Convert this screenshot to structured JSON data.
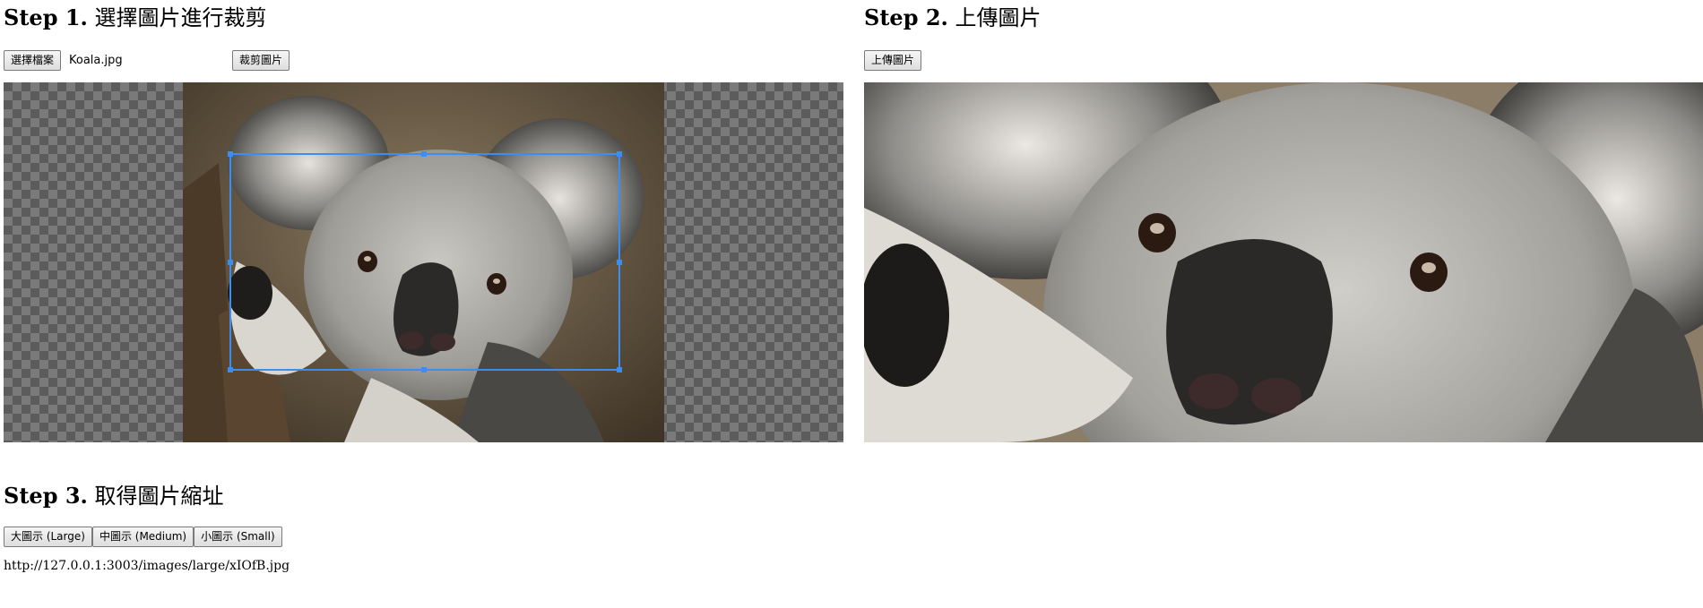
{
  "step1": {
    "number": "Step 1.",
    "title": "選擇圖片進行裁剪",
    "choose_file_label": "選擇檔案",
    "file_name": "Koala.jpg",
    "crop_button_label": "裁剪圖片"
  },
  "step2": {
    "number": "Step 2.",
    "title": "上傳圖片",
    "upload_button_label": "上傳圖片"
  },
  "step3": {
    "number": "Step 3.",
    "title": "取得圖片縮址",
    "buttons": [
      {
        "label": "大圖示 (Large)"
      },
      {
        "label": "中圖示 (Medium)"
      },
      {
        "label": "小圖示 (Small)"
      }
    ],
    "result_url": "http://127.0.0.1:3003/images/large/xIOfB.jpg"
  },
  "colors": {
    "crop_border": "#3b8df0",
    "checker_dark": "#5c5c5c",
    "checker_light": "#7a7a7a"
  }
}
